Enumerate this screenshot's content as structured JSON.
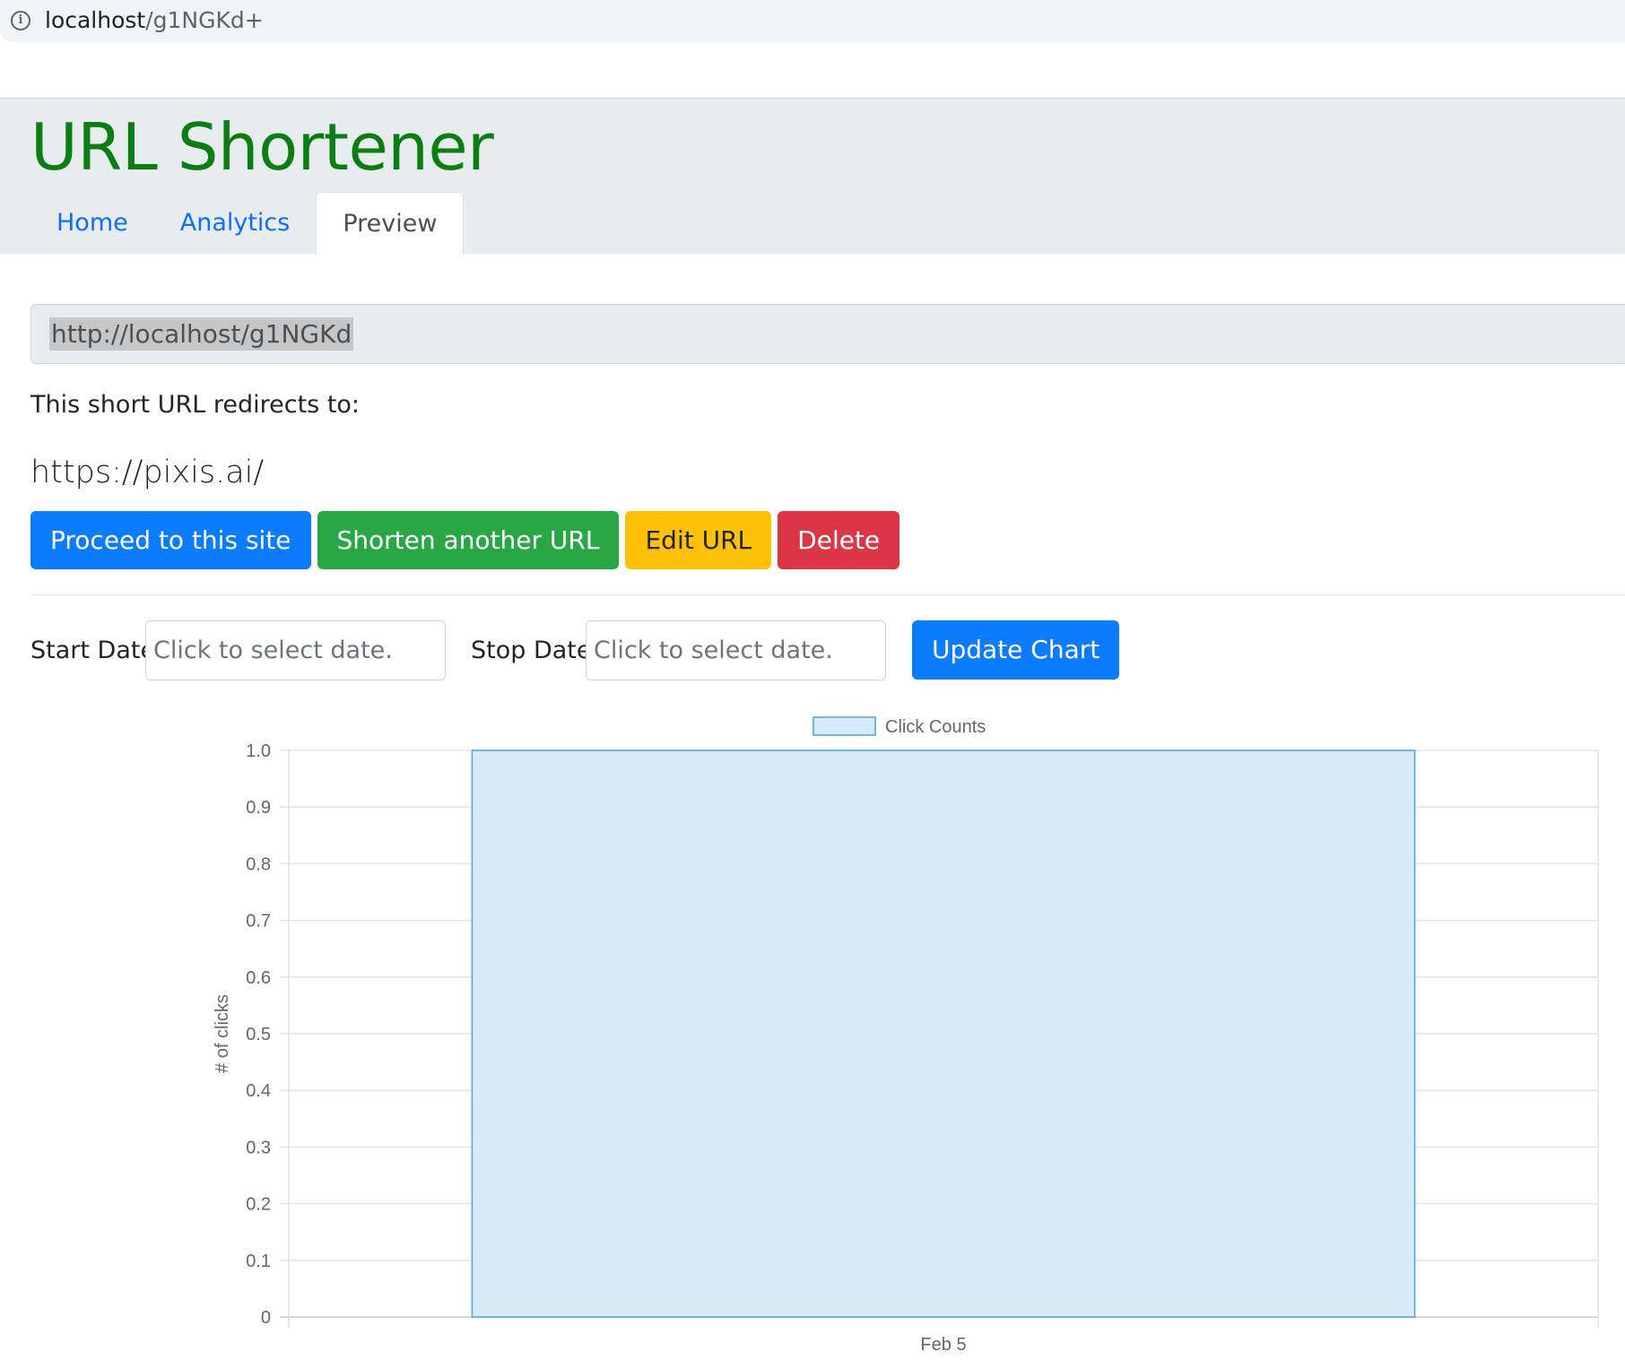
{
  "browser": {
    "address_host": "localhost",
    "address_path": "/g1NGKd+"
  },
  "header": {
    "title": "URL Shortener",
    "tabs": [
      {
        "label": "Home",
        "active": false
      },
      {
        "label": "Analytics",
        "active": false
      },
      {
        "label": "Preview",
        "active": true
      }
    ]
  },
  "short_url": {
    "value": "http://localhost/g1NGKd"
  },
  "redirect": {
    "label": "This short URL redirects to:",
    "target": "https://pixis.ai/"
  },
  "actions": {
    "proceed": "Proceed to this site",
    "shorten": "Shorten another URL",
    "edit": "Edit URL",
    "delete": "Delete"
  },
  "date_filter": {
    "start_label": "Start Date:",
    "start_placeholder": "Click to select date.",
    "stop_label": "Stop Date:",
    "stop_placeholder": "Click to select date.",
    "update_label": "Update Chart"
  },
  "colors": {
    "title_green": "#0a7e12",
    "primary_blue": "#0b7cff",
    "success_green": "#28a745",
    "warning_yellow": "#ffc107",
    "danger_red": "#dc3545",
    "bar_fill": "#d6eaf8",
    "bar_border": "#4aa3df"
  },
  "chart_data": {
    "type": "bar",
    "categories": [
      "Feb 5"
    ],
    "series": [
      {
        "name": "Click Counts",
        "values": [
          1
        ]
      }
    ],
    "xlabel": "",
    "ylabel": "# of clicks",
    "ylim": [
      0,
      1
    ],
    "yticks": [
      "0",
      "0.1",
      "0.2",
      "0.3",
      "0.4",
      "0.5",
      "0.6",
      "0.7",
      "0.8",
      "0.9",
      "1.0"
    ],
    "grid": true,
    "legend": "top-center"
  }
}
